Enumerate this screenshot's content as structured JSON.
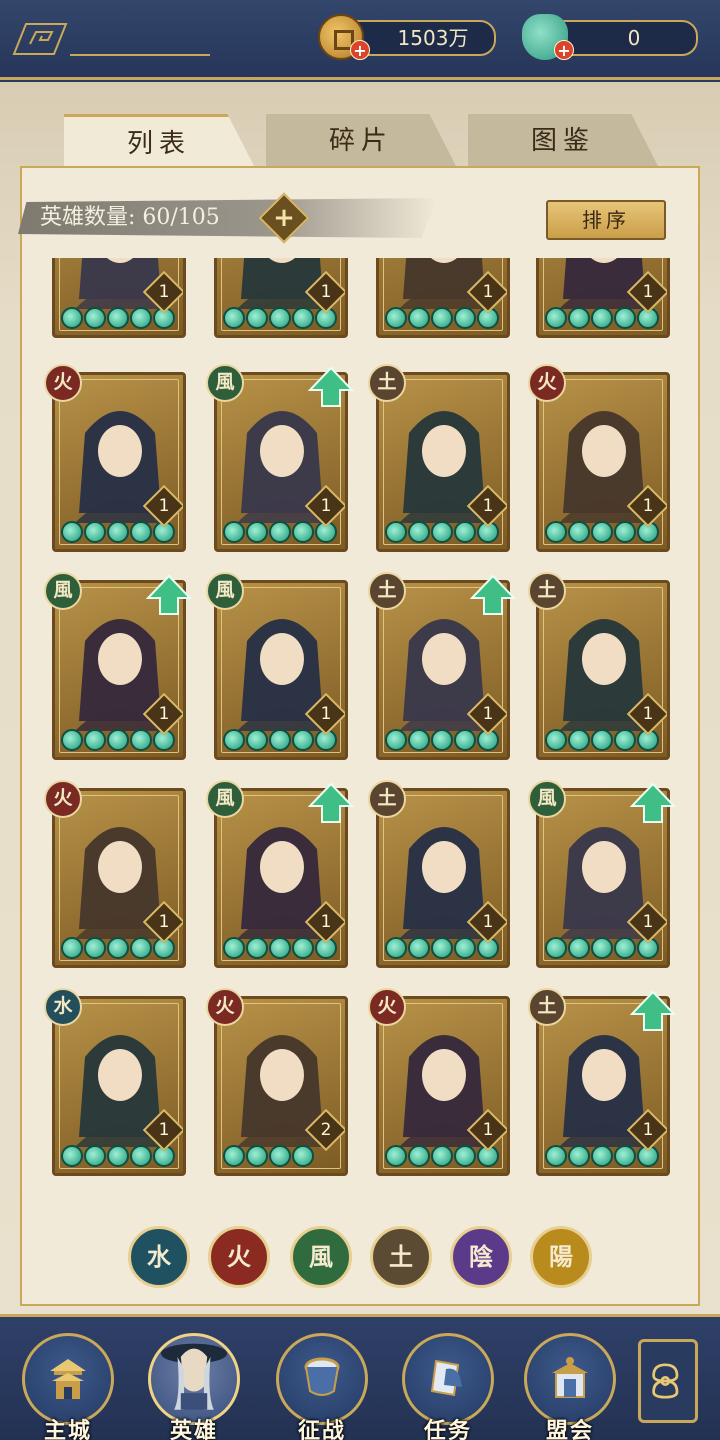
{
  "currencies": {
    "coin": {
      "amount": "1503万",
      "icon": "copper-coin-icon"
    },
    "jade": {
      "amount": "0",
      "icon": "jade-pouch-icon"
    }
  },
  "tabs": [
    {
      "label": "列表",
      "active": true
    },
    {
      "label": "碎片",
      "active": false
    },
    {
      "label": "图鉴",
      "active": false
    }
  ],
  "hero_count": {
    "label": "英雄数量: 60/105"
  },
  "sort_button": "排序",
  "heroes": [
    {
      "element": "",
      "level": "1",
      "stars": 5,
      "upgrade": false,
      "partial": true
    },
    {
      "element": "",
      "level": "1",
      "stars": 5,
      "upgrade": false,
      "partial": true
    },
    {
      "element": "",
      "level": "1",
      "stars": 5,
      "upgrade": false,
      "partial": true
    },
    {
      "element": "",
      "level": "1",
      "stars": 5,
      "upgrade": false,
      "partial": true
    },
    {
      "element": "fire",
      "glyph": "火",
      "level": "1",
      "stars": 5,
      "upgrade": false
    },
    {
      "element": "wind",
      "glyph": "風",
      "level": "1",
      "stars": 5,
      "upgrade": true
    },
    {
      "element": "earth",
      "glyph": "土",
      "level": "1",
      "stars": 5,
      "upgrade": false
    },
    {
      "element": "fire",
      "glyph": "火",
      "level": "1",
      "stars": 5,
      "upgrade": false
    },
    {
      "element": "wind",
      "glyph": "風",
      "level": "1",
      "stars": 5,
      "upgrade": true
    },
    {
      "element": "wind",
      "glyph": "風",
      "level": "1",
      "stars": 5,
      "upgrade": false
    },
    {
      "element": "earth",
      "glyph": "土",
      "level": "1",
      "stars": 5,
      "upgrade": true
    },
    {
      "element": "earth",
      "glyph": "土",
      "level": "1",
      "stars": 5,
      "upgrade": false
    },
    {
      "element": "fire",
      "glyph": "火",
      "level": "1",
      "stars": 5,
      "upgrade": false
    },
    {
      "element": "wind",
      "glyph": "風",
      "level": "1",
      "stars": 5,
      "upgrade": true
    },
    {
      "element": "earth",
      "glyph": "土",
      "level": "1",
      "stars": 5,
      "upgrade": false
    },
    {
      "element": "wind",
      "glyph": "風",
      "level": "1",
      "stars": 5,
      "upgrade": true
    },
    {
      "element": "water",
      "glyph": "水",
      "level": "1",
      "stars": 5,
      "upgrade": false
    },
    {
      "element": "fire",
      "glyph": "火",
      "level": "2",
      "stars": 4,
      "upgrade": false
    },
    {
      "element": "fire",
      "glyph": "火",
      "level": "1",
      "stars": 5,
      "upgrade": false
    },
    {
      "element": "earth",
      "glyph": "土",
      "level": "1",
      "stars": 5,
      "upgrade": true
    }
  ],
  "element_filters": [
    {
      "name": "water",
      "glyph": "水",
      "color": "#1f5160"
    },
    {
      "name": "fire",
      "glyph": "火",
      "color": "#8a2a20"
    },
    {
      "name": "wind",
      "glyph": "風",
      "color": "#2f6b3c"
    },
    {
      "name": "earth",
      "glyph": "土",
      "color": "#5b4a34"
    },
    {
      "name": "yin",
      "glyph": "陰",
      "color": "#5c3a8a"
    },
    {
      "name": "yang",
      "glyph": "陽",
      "color": "#b98a1c"
    }
  ],
  "bottom_nav": [
    {
      "label": "主城",
      "icon": "city-gate-icon",
      "active": false
    },
    {
      "label": "英雄",
      "icon": "hero-portrait-icon",
      "active": true
    },
    {
      "label": "征战",
      "icon": "war-drum-icon",
      "active": false
    },
    {
      "label": "任务",
      "icon": "scroll-bell-icon",
      "active": false
    },
    {
      "label": "盟会",
      "icon": "pavilion-icon",
      "active": false
    }
  ],
  "more_button": {
    "icon": "lattice-menu-icon"
  },
  "colors": {
    "frame_navy": "#2b3a5c",
    "gold_trim": "#c9a85a",
    "parchment": "#f1ead8",
    "star_jade": "#1e9a7a",
    "upgrade_green": "#3fbf86"
  }
}
